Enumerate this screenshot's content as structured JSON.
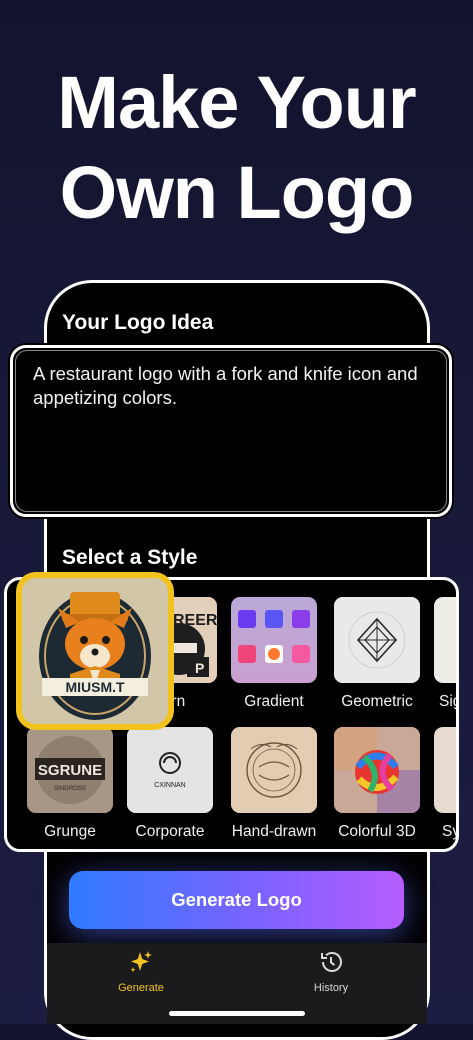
{
  "headline": {
    "line1": "Make Your",
    "line2": "Own Logo"
  },
  "idea_section": {
    "title": "Your Logo Idea",
    "text": "A restaurant logo with a fork and knife icon and appetizing colors."
  },
  "style_section": {
    "title": "Select a Style",
    "selected_tile_text": "MIUSM.T",
    "styles_row1": [
      "Mascot",
      "Modern",
      "Gradient",
      "Geometric",
      "Signature"
    ],
    "row1_visible_labels": [
      "ern",
      "Gradient",
      "Geometric",
      "Sig"
    ],
    "styles_row2": [
      "Grunge",
      "Corporate",
      "Hand-drawn",
      "Colorful 3D",
      "Sy"
    ],
    "tile_texts": {
      "modern_top": "REER",
      "modern_letter": "P",
      "grunge_title": "SGRUNE",
      "grunge_sub": "SINGROSS",
      "corporate_text": "CXINNAN"
    }
  },
  "generate_button": {
    "label": "Generate Logo"
  },
  "tabbar": {
    "items": [
      {
        "label": "Generate",
        "icon": "sparkles-icon",
        "active": true
      },
      {
        "label": "History",
        "icon": "history-clock-icon",
        "active": false
      }
    ]
  },
  "colors": {
    "accent_yellow": "#f2c21e",
    "button_start": "#2f7bff",
    "button_end": "#b65dff",
    "background": "#191a3a"
  }
}
